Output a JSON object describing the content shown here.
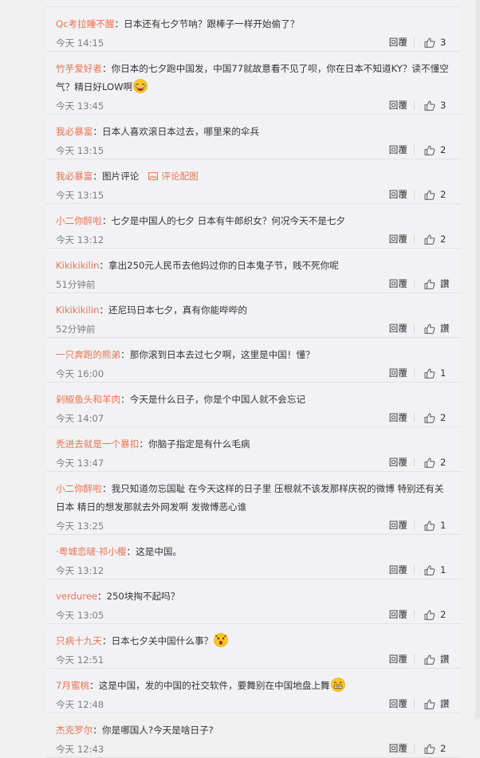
{
  "reply_label": "回覆",
  "like_default": "讚",
  "pic_link_label": "评论配图",
  "comments": [
    {
      "author": "Qc考拉睡不醒",
      "text": "日本还有七夕节呐？跟棒子一样开始偷了？",
      "time": "今天 14:15",
      "likes": "3"
    },
    {
      "author": "竹芋爱好者",
      "text": "你日本的七夕跑中国发，中国77就故意看不见了呗，你在日本不知道KY？读不懂空气？精日好LOW啊",
      "emoji": "laugh",
      "time": "今天 13:45",
      "likes": "3"
    },
    {
      "author": "我必暴富",
      "text": "日本人喜欢滚日本过去，哪里来的伞兵",
      "time": "今天 13:15",
      "likes": "2"
    },
    {
      "author": "我必暴富",
      "text": "图片评论",
      "pic": true,
      "time": "今天 13:15",
      "likes": "2"
    },
    {
      "author": "小二你醉啦",
      "text": "七夕是中国人的七夕 日本有牛郎织女？何况今天不是七夕",
      "time": "今天 13:12",
      "likes": "2"
    },
    {
      "author": "Kikikikilin",
      "text": "拿出250元人民币去他妈过你的日本鬼子节，贱不死你呢",
      "time": "51分钟前",
      "likes": "讚"
    },
    {
      "author": "Kikikikilin",
      "text": "还尼玛日本七夕，真有你能哔哔的",
      "time": "52分钟前",
      "likes": "讚"
    },
    {
      "author": "一只奔跑的熊弟",
      "text": "那你滚到日本去过七夕啊，这里是中国！懂？",
      "time": "今天 16:00",
      "likes": "1"
    },
    {
      "author": "剁椒鱼头和羊肉",
      "text": "今天是什么日子，你是个中国人就不会忘记",
      "time": "今天 14:07",
      "likes": "2"
    },
    {
      "author": "秃进去就是一个暴扣",
      "text": "你脑子指定是有什么毛病",
      "time": "今天 13:47",
      "likes": "2"
    },
    {
      "author": "小二你醉啦",
      "text": "我只知道勿忘国耻 在今天这样的日子里 压根就不该发那样庆祝的微博 特别还有关日本 精日的想发那就去外网发啊 发微博恶心谁",
      "time": "今天 13:25",
      "likes": "1"
    },
    {
      "author": "·粤城恋啵·祁小樱",
      "text": "这是中国。",
      "time": "今天 13:12",
      "likes": "1"
    },
    {
      "author": "verduree",
      "text": "250块掏不起吗？",
      "time": "今天 13:05",
      "likes": "2"
    },
    {
      "author": "只病十九天",
      "text": "日本七夕关中国什么事？",
      "emoji": "shock",
      "time": "今天 12:51",
      "likes": "讚"
    },
    {
      "author": "7月蜜桃",
      "text": "这是中国，发的中国的社交软件，要舞别在中国地盘上舞",
      "emoji": "grin",
      "time": "今天 12:48",
      "likes": "讚"
    },
    {
      "author": "杰克罗尔",
      "text": "你是哪国人?今天是啥日子?",
      "time": "今天 12:43",
      "likes": "2"
    }
  ]
}
